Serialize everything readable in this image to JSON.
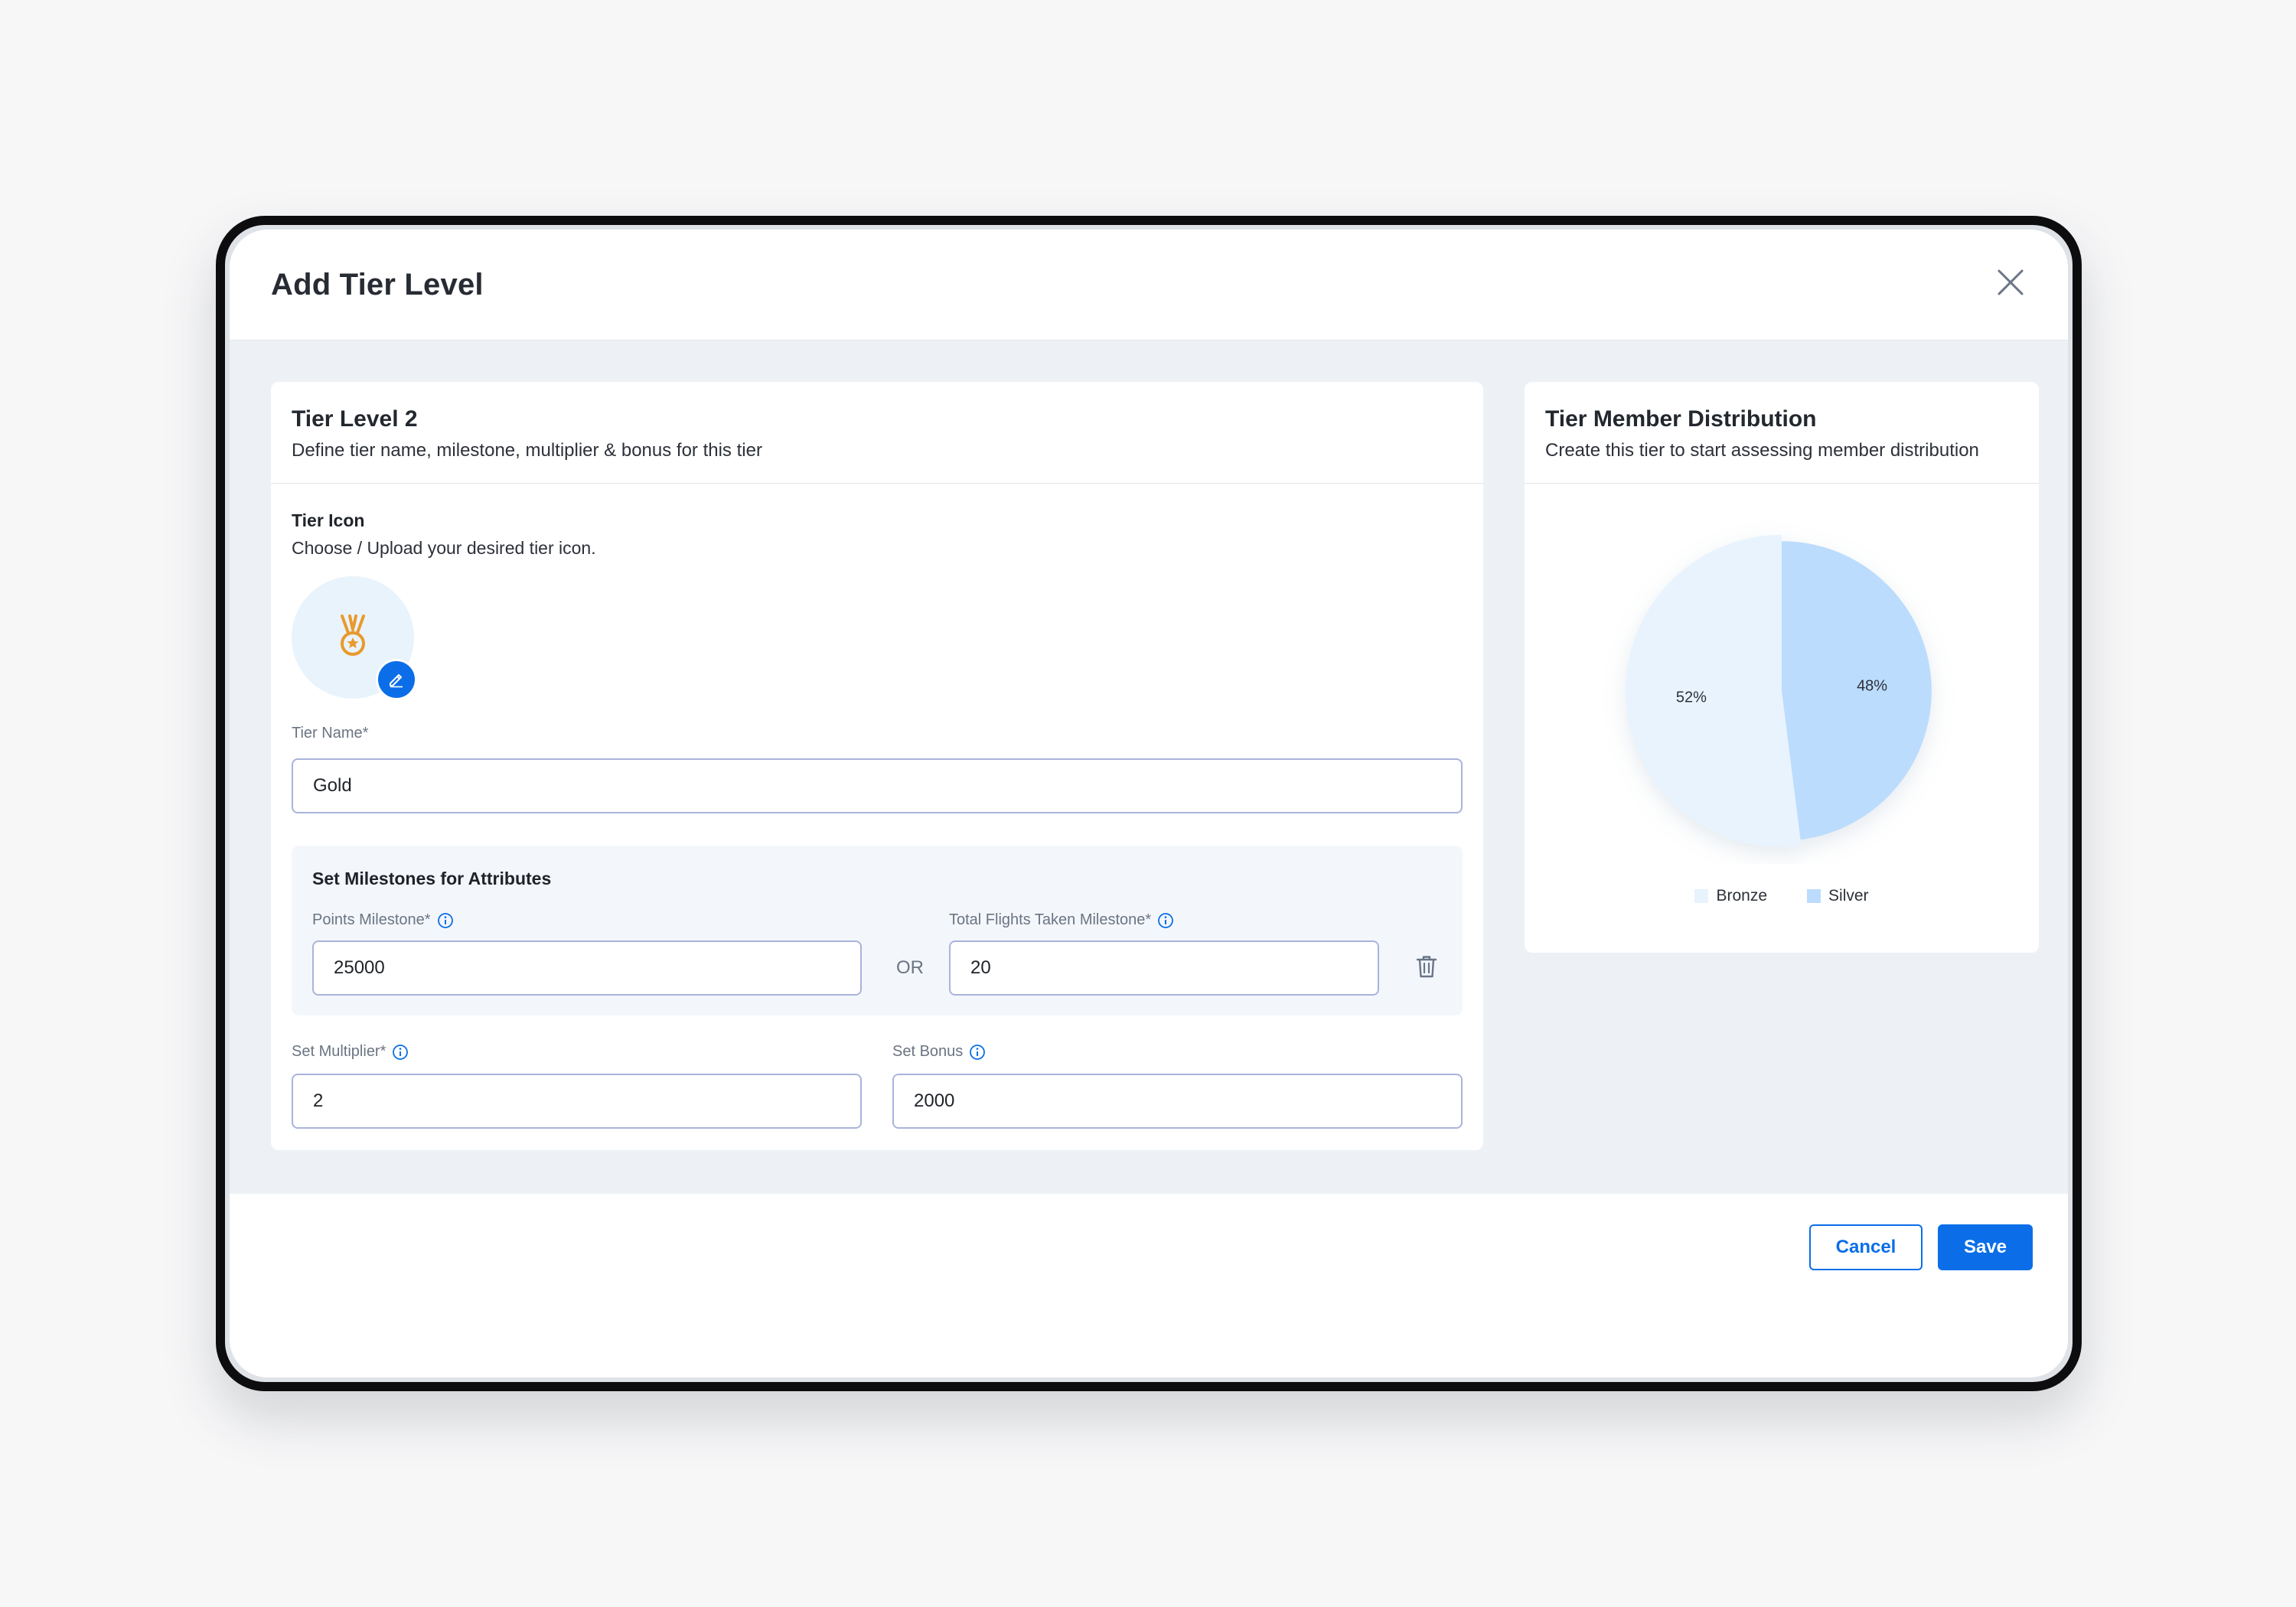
{
  "dialog": {
    "title": "Add Tier Level"
  },
  "tier_card": {
    "title": "Tier Level 2",
    "subtitle": "Define tier name, milestone, multiplier & bonus for this tier",
    "icon_section": {
      "label": "Tier Icon",
      "hint": "Choose / Upload your desired tier icon.",
      "icon": "medal-icon",
      "edit_icon": "pencil-icon"
    },
    "tier_name": {
      "label": "Tier Name*",
      "value": "Gold"
    },
    "milestones": {
      "title": "Set Milestones for Attributes",
      "points": {
        "label": "Points Milestone*",
        "value": "25000"
      },
      "separator": "OR",
      "flights": {
        "label": "Total Flights Taken Milestone*",
        "value": "20"
      },
      "delete_icon": "trash-icon"
    },
    "multiplier": {
      "label": "Set Multiplier*",
      "value": "2"
    },
    "bonus": {
      "label": "Set Bonus",
      "value": "2000"
    }
  },
  "distribution_card": {
    "title": "Tier Member Distribution",
    "subtitle": "Create this tier to start assessing member distribution"
  },
  "chart_data": {
    "type": "pie",
    "labels": [
      "Bronze",
      "Silver"
    ],
    "values": [
      52,
      48
    ],
    "value_labels": [
      "52%",
      "48%"
    ],
    "colors": [
      "#e8f3fe",
      "#bcdcfd"
    ],
    "legend_position": "bottom"
  },
  "footer": {
    "cancel_label": "Cancel",
    "save_label": "Save"
  },
  "colors": {
    "primary": "#0b6ee8",
    "medal": "#e89a2c",
    "input_border": "#a9b4dc"
  }
}
